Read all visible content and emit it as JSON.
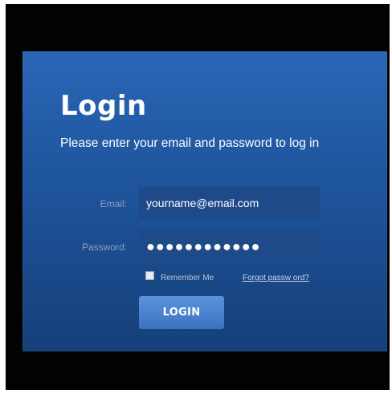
{
  "login": {
    "title": "Login",
    "subtitle": "Please enter your email and password to log in",
    "email_label": "Email:",
    "email_value": "yourname@email.com",
    "password_label": "Password:",
    "password_value": "●●●●●●●●●●●●",
    "remember_label": "Remember Me",
    "remember_checked": false,
    "forgot_link": "Forgot passw ord?",
    "submit_label": "LOGIN"
  },
  "colors": {
    "panel_top": "#2a66b6",
    "panel_bottom": "#163f79",
    "field_bg": "#1f4a89",
    "button_top": "#5a93dc",
    "button_bottom": "#3b73c2",
    "frame": "#020202"
  }
}
